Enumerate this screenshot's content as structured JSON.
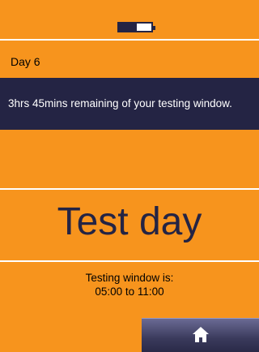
{
  "header": {
    "battery_level": 0.55,
    "battery_icon": "battery-icon"
  },
  "day": {
    "label": "Day 6"
  },
  "banner": {
    "text": "3hrs 45mins remaining of your testing window."
  },
  "main": {
    "title": "Test day",
    "window_line1": "Testing window is:",
    "window_line2": "05:00 to 11:00"
  },
  "nav": {
    "home_icon": "home-icon"
  },
  "colors": {
    "background": "#f7941d",
    "dark": "#242444",
    "divider": "#ffffff"
  }
}
